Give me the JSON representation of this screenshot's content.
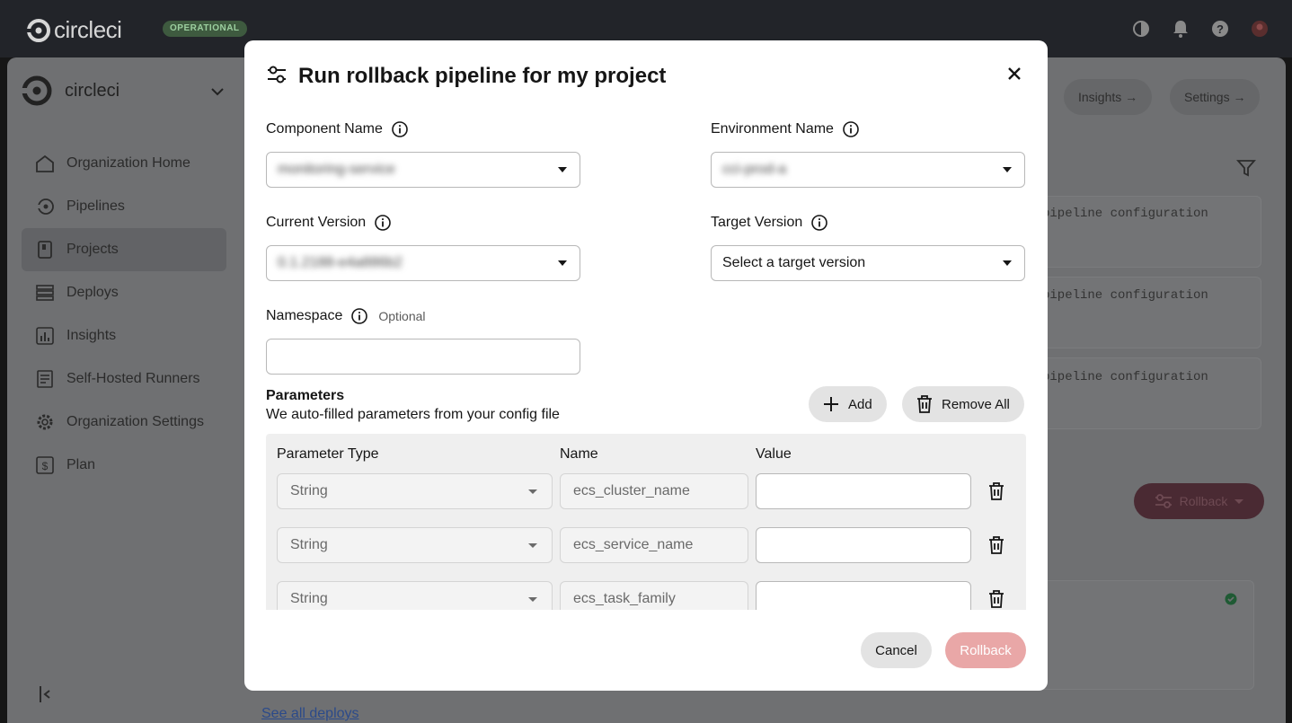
{
  "app": {
    "logo_text": "circleci",
    "status_badge": "OPERATIONAL"
  },
  "sidebar": {
    "org_name": "circleci",
    "items": [
      {
        "label": "Organization Home",
        "icon": "home-icon"
      },
      {
        "label": "Pipelines",
        "icon": "pipelines-icon"
      },
      {
        "label": "Projects",
        "icon": "projects-icon",
        "active": true
      },
      {
        "label": "Deploys",
        "icon": "deploys-icon"
      },
      {
        "label": "Insights",
        "icon": "insights-icon"
      },
      {
        "label": "Self-Hosted Runners",
        "icon": "runners-icon"
      },
      {
        "label": "Organization Settings",
        "icon": "gear-icon"
      },
      {
        "label": "Plan",
        "icon": "plan-icon"
      }
    ]
  },
  "background": {
    "insights_button": "Insights →",
    "settings_button": "Settings →",
    "card_text": "pipeline configuration",
    "rollback_button": "Rollback",
    "see_all_link": "See all deploys"
  },
  "modal": {
    "title": "Run rollback pipeline for my project",
    "component": {
      "label": "Component Name",
      "value": "monitoring-service"
    },
    "environment": {
      "label": "Environment Name",
      "value": "cci-prod-a"
    },
    "current_version": {
      "label": "Current Version",
      "value": "0.1.2188-e4a886b2"
    },
    "target_version": {
      "label": "Target Version",
      "placeholder": "Select a target version"
    },
    "namespace": {
      "label": "Namespace",
      "optional": "Optional",
      "value": ""
    },
    "parameters": {
      "title": "Parameters",
      "subtitle": "We auto-filled parameters from your config file",
      "add_label": "Add",
      "remove_all_label": "Remove All",
      "columns": [
        "Parameter Type",
        "Name",
        "Value"
      ],
      "rows": [
        {
          "type": "String",
          "name": "ecs_cluster_name",
          "value": ""
        },
        {
          "type": "String",
          "name": "ecs_service_name",
          "value": ""
        },
        {
          "type": "String",
          "name": "ecs_task_family",
          "value": ""
        }
      ]
    },
    "cancel_label": "Cancel",
    "rollback_label": "Rollback"
  },
  "colors": {
    "primary_disabled": "#e9a7a7",
    "status_green": "#3e5a3f"
  }
}
